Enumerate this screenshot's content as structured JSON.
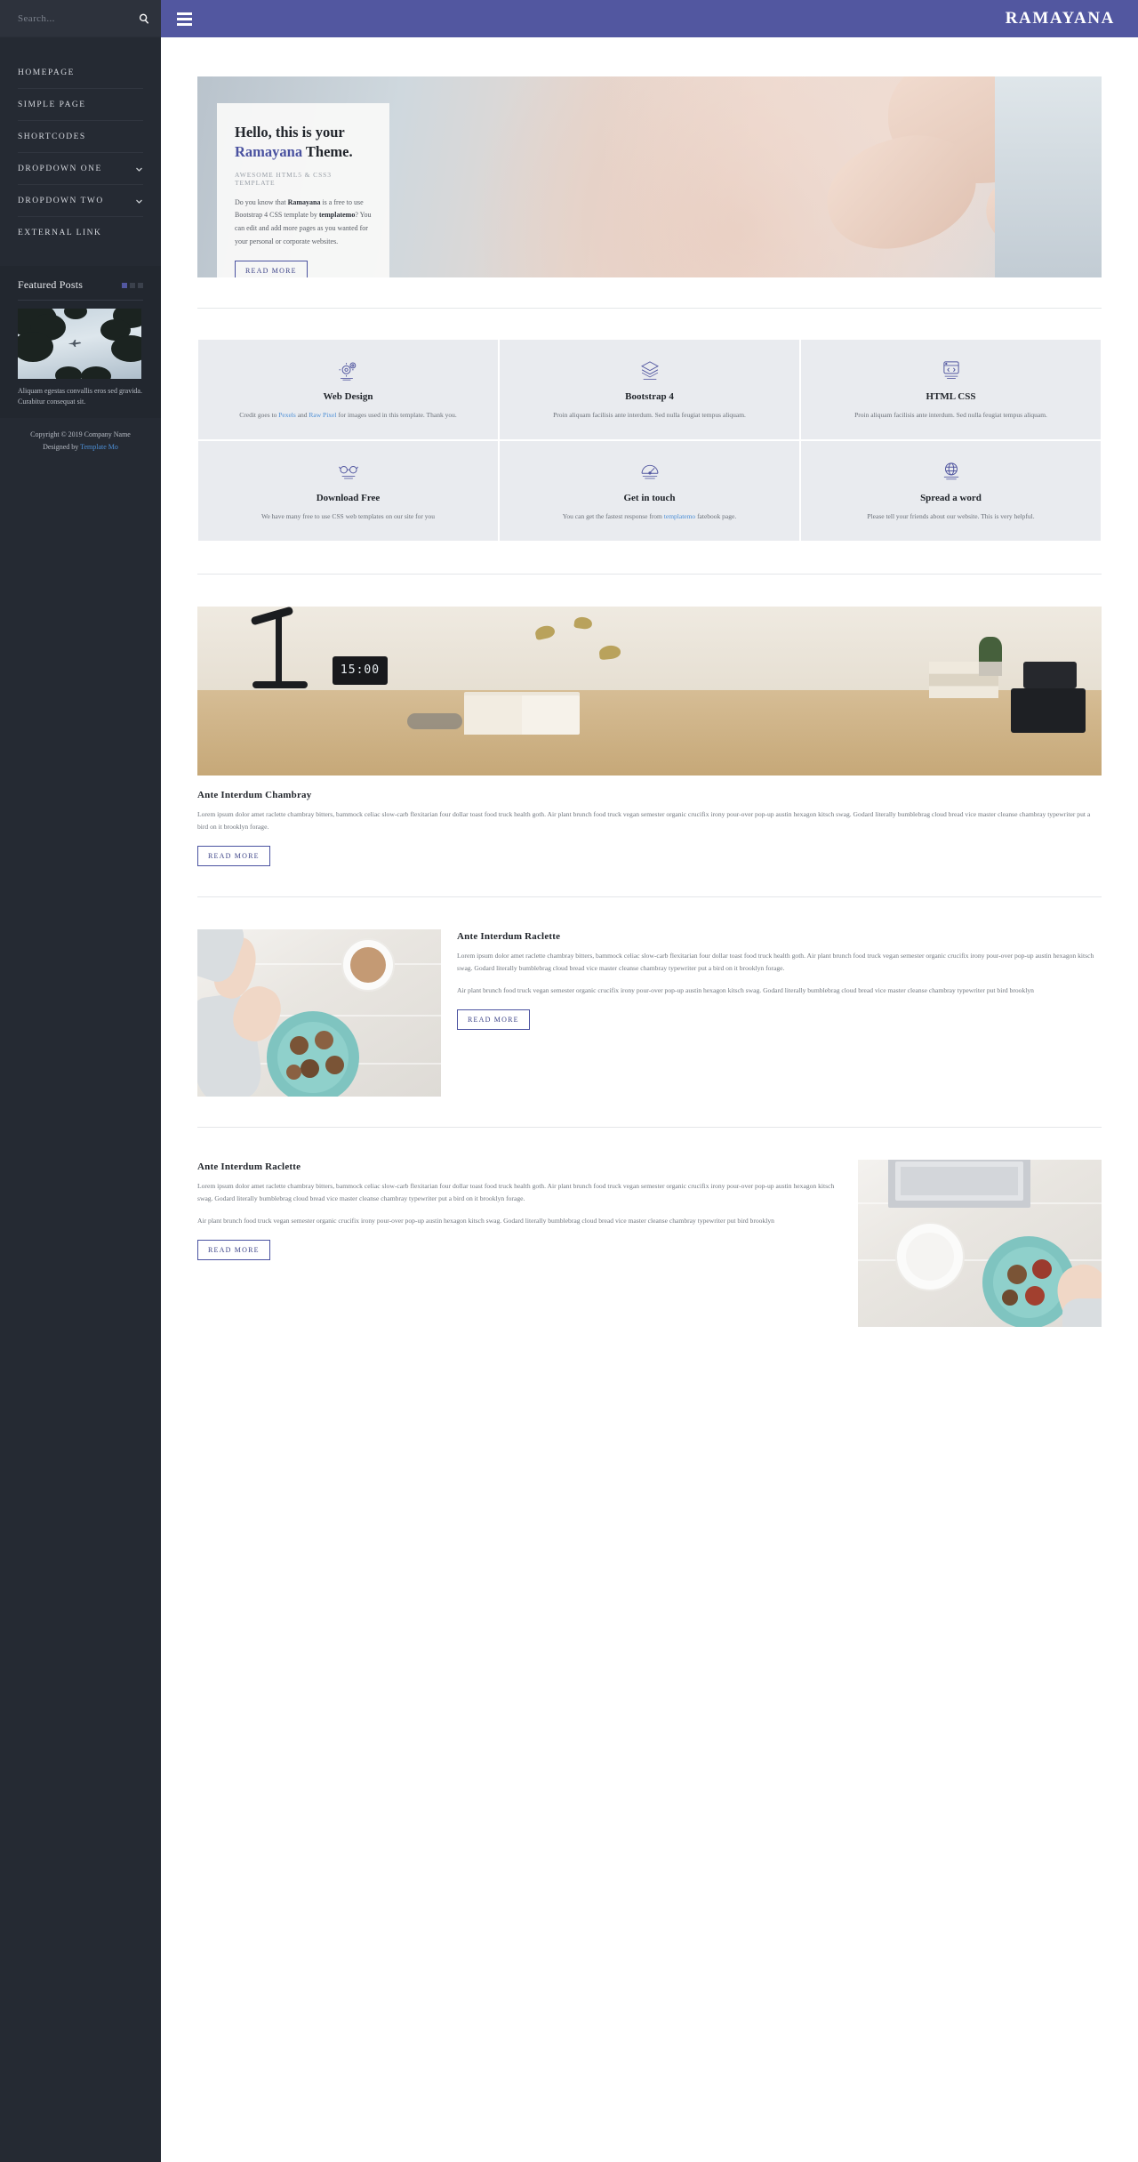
{
  "sidebar": {
    "search": {
      "placeholder": "Search...",
      "value": "",
      "icon": "search-icon"
    },
    "nav_items": [
      {
        "label": "HOMEPAGE",
        "has_chevron": false
      },
      {
        "label": "SIMPLE PAGE",
        "has_chevron": false
      },
      {
        "label": "SHORTCODES",
        "has_chevron": false
      },
      {
        "label": "DROPDOWN ONE",
        "has_chevron": true
      },
      {
        "label": "DROPDOWN TWO",
        "has_chevron": true
      },
      {
        "label": "EXTERNAL LINK",
        "has_chevron": false
      }
    ],
    "widget": {
      "title": "Featured Posts",
      "caption": "Aliquam egestas convallis eros sed gravida. Curabitur consequat sit.",
      "dots": 3,
      "active_dot": 0
    },
    "footer": {
      "copyright": "Copyright © 2019 Company Name",
      "designed_prefix": "Designed by ",
      "designed_link": "Template Mo"
    }
  },
  "header": {
    "brand": "RAMAYANA",
    "menu_icon": "hamburger-icon"
  },
  "hero": {
    "heading_line1": "Hello, this is your",
    "heading_accent": "Ramayana",
    "heading_line2_rest": " Theme.",
    "subtitle": "AWESOME HTML5 & CSS3 TEMPLATE",
    "paragraph_1": "Do you know that ",
    "paragraph_bold_1": "Ramayana",
    "paragraph_2": " is a free to use Bootstrap 4 CSS template by ",
    "paragraph_bold_2": "templatemo",
    "paragraph_3": "? You can edit and add more pages as you wanted for your personal or corporate websites.",
    "button": "READ MORE"
  },
  "features": [
    {
      "icon": "gears-icon",
      "title": "Web Design",
      "desc_pre": "Credit goes to ",
      "link1": "Pexels",
      "desc_mid": " and ",
      "link2": "Raw Pixel",
      "desc_post": " for images used in this template. Thank you."
    },
    {
      "icon": "layers-icon",
      "title": "Bootstrap 4",
      "desc_pre": "Proin aliquam facilisis ante interdum. Sed nulla feugiat tempus aliquam.",
      "link1": "",
      "desc_mid": "",
      "link2": "",
      "desc_post": ""
    },
    {
      "icon": "browser-icon",
      "title": "HTML CSS",
      "desc_pre": "Proin aliquam facilisis ante interdum. Sed nulla feugiat tempus aliquam.",
      "link1": "",
      "desc_mid": "",
      "link2": "",
      "desc_post": ""
    },
    {
      "icon": "glasses-icon",
      "title": "Download Free",
      "desc_pre": "We have many free to use CSS web templates on our site for you",
      "link1": "",
      "desc_mid": "",
      "link2": "",
      "desc_post": ""
    },
    {
      "icon": "speedometer-icon",
      "title": "Get in touch",
      "desc_pre": "You can get the fastest response from ",
      "link1": "templatemo",
      "desc_mid": " fatebook page.",
      "link2": "",
      "desc_post": ""
    },
    {
      "icon": "globe-icon",
      "title": "Spread a word",
      "desc_pre": "Please tell your friends about our website. This is very helpful.",
      "link1": "",
      "desc_mid": "",
      "link2": "",
      "desc_post": ""
    }
  ],
  "posts": [
    {
      "layout": "full",
      "title": "Ante Interdum Chambray",
      "body_1": "Lorem ipsum dolor amet raclette chambray bitters, bammock celiac slow-carb flexitarian four dollar toast food truck health goth. Air plant brunch food truck vegan semester organic crucifix irony pour-over pop-up austin hexagon kitsch swag. Godard literally bumblebrag cloud bread vice master cleanse chambray typewriter put a bird on it brooklyn forage.",
      "body_2": "",
      "button": "READ MORE",
      "image": "desk-workspace-photo",
      "clock_time": "15:00"
    },
    {
      "layout": "image-left",
      "title": "Ante Interdum Raclette",
      "body_1": "Lorem ipsum dolor amet raclette chambray bitters, bammock celiac slow-carb flexitarian four dollar toast food truck health goth. Air plant brunch food truck vegan semester organic crucifix irony pour-over pop-up austin hexagon kitsch swag. Godard literally bumblebrag cloud bread vice master cleanse chambray typewriter put a bird on it brooklyn forage.",
      "body_2": "Air plant brunch food truck vegan semester organic crucifix irony pour-over pop-up austin hexagon kitsch swag. Godard literally bumblebrag cloud bread vice master cleanse chambray typewriter put bird brooklyn",
      "button": "READ MORE",
      "image": "coffee-chocolates-photo",
      "clock_time": ""
    },
    {
      "layout": "image-right",
      "title": "Ante Interdum Raclette",
      "body_1": "Lorem ipsum dolor amet raclette chambray bitters, bammock celiac slow-carb flexitarian four dollar toast food truck health goth. Air plant brunch food truck vegan semester organic crucifix irony pour-over pop-up austin hexagon kitsch swag. Godard literally bumblebrag cloud bread vice master cleanse chambray typewriter put a bird on it brooklyn forage.",
      "body_2": "Air plant brunch food truck vegan semester organic crucifix irony pour-over pop-up austin hexagon kitsch swag. Godard literally bumblebrag cloud bread vice master cleanse chambray typewriter put bird brooklyn",
      "button": "READ MORE",
      "image": "laptop-coffee-photo",
      "clock_time": ""
    }
  ],
  "colors": {
    "sidebar_bg": "#252a33",
    "header_purple": "#5257a0",
    "accent_blue": "#4a52a0",
    "link_blue": "#4d8fd6",
    "card_grey": "#e9ebef"
  }
}
